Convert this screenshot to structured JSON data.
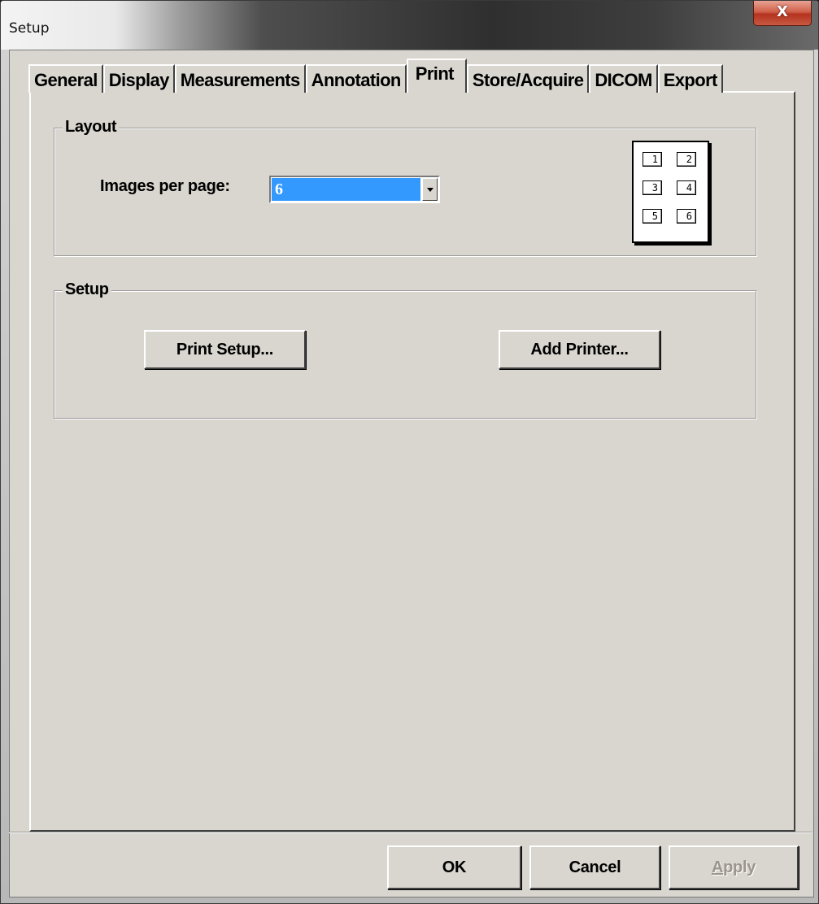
{
  "window": {
    "title": "Setup",
    "close_glyph": "X"
  },
  "tabs": [
    {
      "label": "General",
      "active": false
    },
    {
      "label": "Display",
      "active": false
    },
    {
      "label": "Measurements",
      "active": false
    },
    {
      "label": "Annotation",
      "active": false
    },
    {
      "label": "Print",
      "active": true
    },
    {
      "label": "Store/Acquire",
      "active": false
    },
    {
      "label": "DICOM",
      "active": false
    },
    {
      "label": "Export",
      "active": false
    }
  ],
  "layout_group": {
    "title": "Layout",
    "images_per_page_label": "Images per page:",
    "images_per_page_value": "6",
    "preview_cells": [
      "1",
      "2",
      "3",
      "4",
      "5",
      "6"
    ]
  },
  "setup_group": {
    "title": "Setup",
    "print_setup_label": "Print Setup...",
    "add_printer_label": "Add Printer..."
  },
  "footer": {
    "ok_label": "OK",
    "cancel_label": "Cancel",
    "apply_accel": "A",
    "apply_rest": "pply"
  },
  "colors": {
    "dialog_bg": "#d9d5cf",
    "selection": "#3399ff",
    "close_button": "#c85a43"
  }
}
